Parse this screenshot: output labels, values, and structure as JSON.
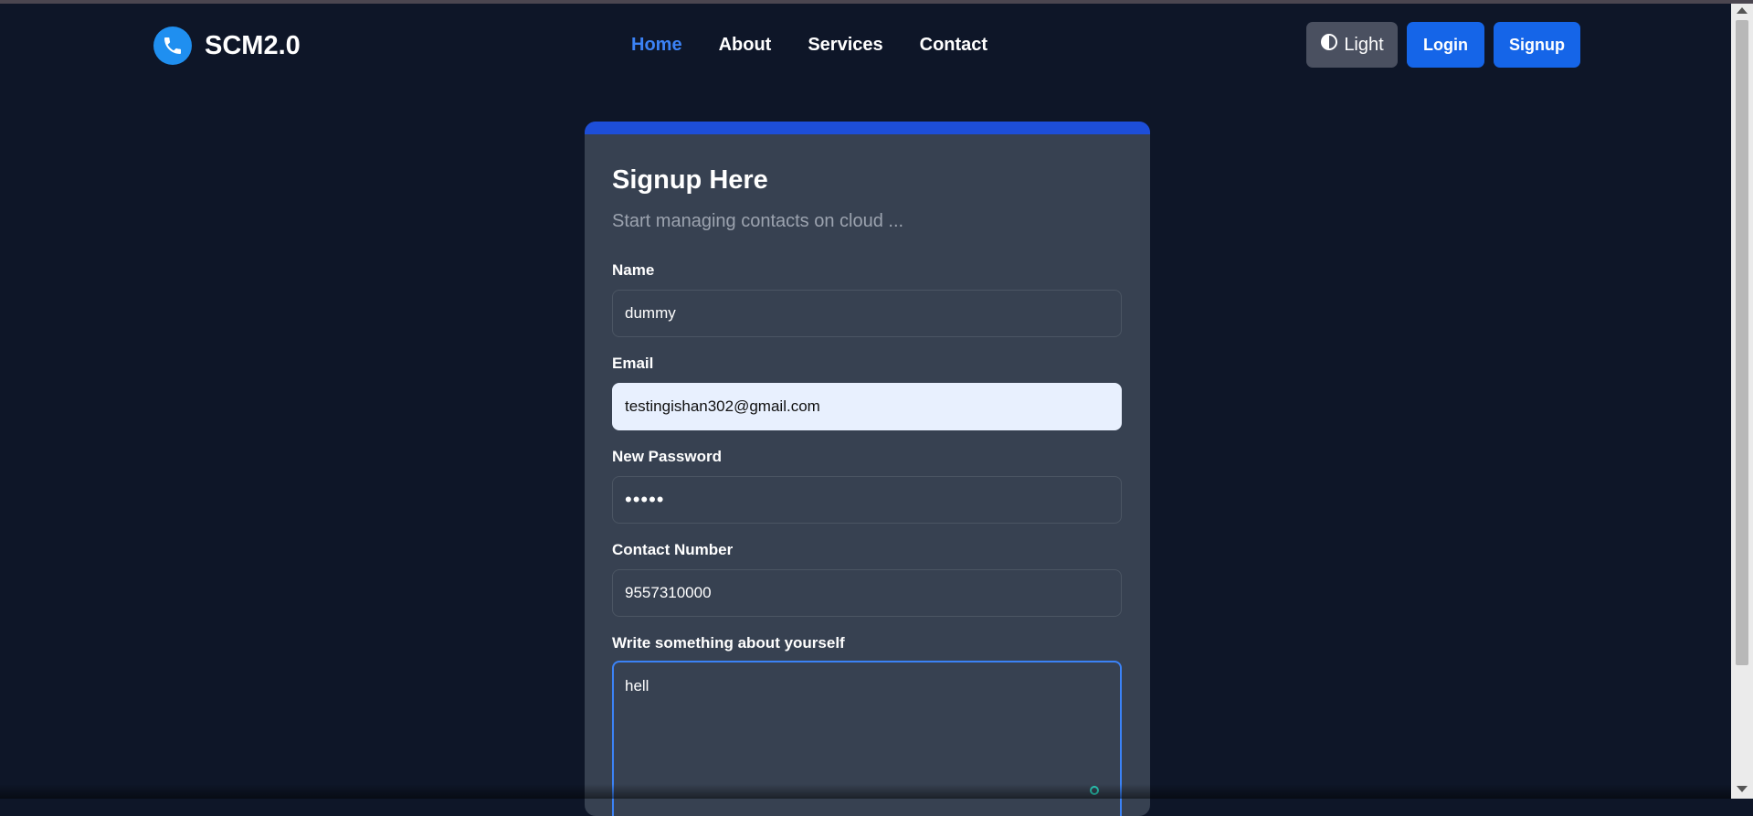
{
  "brand": {
    "name": "SCM2.0",
    "logo_icon": "phone-icon"
  },
  "nav": {
    "links": [
      {
        "label": "Home",
        "active": true
      },
      {
        "label": "About",
        "active": false
      },
      {
        "label": "Services",
        "active": false
      },
      {
        "label": "Contact",
        "active": false
      }
    ]
  },
  "actions": {
    "theme_label": "Light",
    "theme_icon": "half-circle-icon",
    "login_label": "Login",
    "signup_label": "Signup"
  },
  "form": {
    "title": "Signup Here",
    "subtitle": "Start managing contacts on cloud ...",
    "name_label": "Name",
    "name_value": "dummy",
    "email_label": "Email",
    "email_value": "testingishan302@gmail.com",
    "password_label": "New Password",
    "password_value": "•••••",
    "phone_label": "Contact Number",
    "phone_value": "9557310000",
    "about_label": "Write something about yourself",
    "about_value": "hell"
  },
  "colors": {
    "background": "#0e1628",
    "accent": "#1565e8",
    "active_link": "#3b82f6",
    "card": "#374151",
    "card_top": "#1d4ed8"
  }
}
